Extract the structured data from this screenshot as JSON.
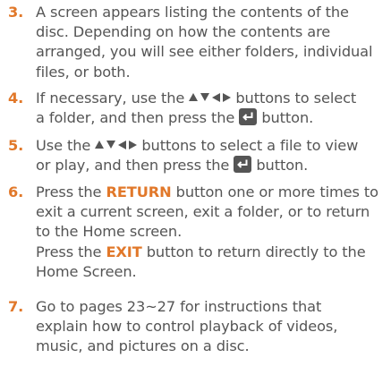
{
  "colors": {
    "accent": "#e1782a",
    "text": "#555555"
  },
  "icons": {
    "direction_buttons": [
      "up-arrow-icon",
      "down-arrow-icon",
      "left-arrow-icon",
      "right-arrow-icon"
    ],
    "enter_button": "enter-button-icon"
  },
  "steps": [
    {
      "number": "3.",
      "lines": [
        "A screen appears listing the contents of the",
        "disc. Depending on how the contents are",
        "arranged, you will see either folders, individual",
        "files, or both."
      ]
    },
    {
      "number": "4.",
      "line1_before": "If necessary, use the",
      "line1_after": "buttons to select",
      "line2_before": "a folder, and then press the",
      "line2_after": "button."
    },
    {
      "number": "5.",
      "line1_before": "Use the",
      "line1_after": "buttons to select a file to view",
      "line2_before": "or play, and then press the",
      "line2_after": "button."
    },
    {
      "number": "6.",
      "line1_before": "Press the",
      "line1_key": "RETURN",
      "line1_after": "button one or more times to",
      "line2": "exit a current screen, exit a folder, or to return",
      "line3": "to the Home screen.",
      "line4_before": "Press the",
      "line4_key": "EXIT",
      "line4_after": "button to return directly to the",
      "line5": "Home Screen."
    },
    {
      "number": "7.",
      "lines": [
        "Go to pages 23~27 for instructions that",
        "explain how to control playback of videos,",
        "music, and pictures on a disc."
      ]
    }
  ]
}
